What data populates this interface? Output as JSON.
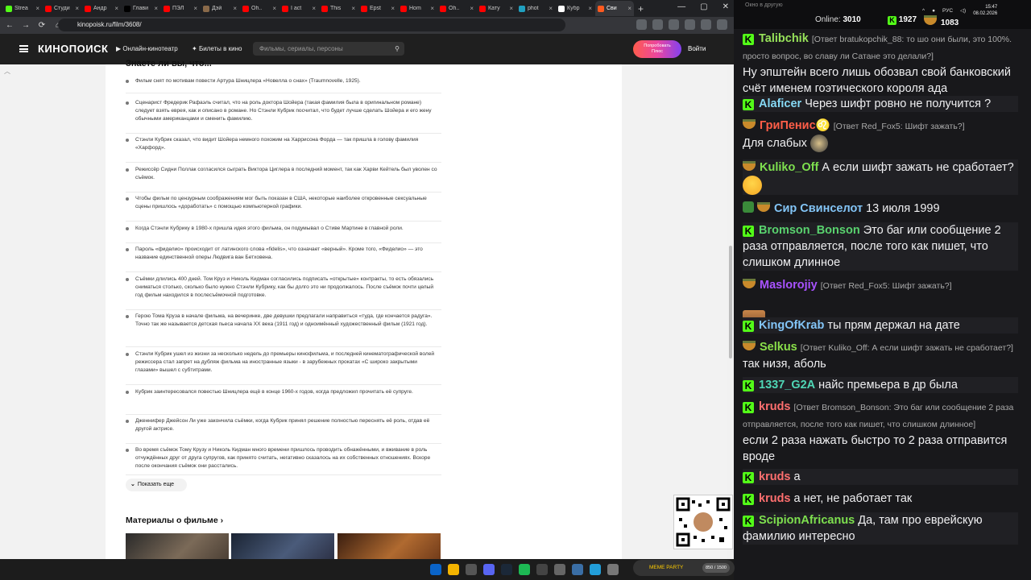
{
  "browser": {
    "tabs": [
      {
        "label": "Strea",
        "color": "#53fc18"
      },
      {
        "label": "Студи",
        "color": "#ff0000"
      },
      {
        "label": "Андр",
        "color": "#ff0000"
      },
      {
        "label": "Глави",
        "color": "#000000"
      },
      {
        "label": "ПЭЛ",
        "color": "#ff0000"
      },
      {
        "label": "Дэй",
        "color": "#8a6a4a"
      },
      {
        "label": "Oh..",
        "color": "#ff0000"
      },
      {
        "label": "I act",
        "color": "#ff0000"
      },
      {
        "label": "This",
        "color": "#ff0000"
      },
      {
        "label": "Epst",
        "color": "#ff0000"
      },
      {
        "label": "Hom",
        "color": "#ff0000"
      },
      {
        "label": "Oh..",
        "color": "#ff0000"
      },
      {
        "label": "Кату",
        "color": "#ff0000"
      },
      {
        "label": "phot",
        "color": "#20a0c0"
      },
      {
        "label": "Кубр",
        "color": "#ffffff"
      },
      {
        "label": "Сви",
        "color": "#ff5a1f",
        "active": true
      }
    ],
    "url": "kinopoisk.ru/film/3608/"
  },
  "header": {
    "logo": "КИНОПОИСК",
    "nav1": "Онлайн-кинотеатр",
    "nav2": "Билеты в кино",
    "search_placeholder": "Фильмы, сериалы, персоны",
    "try_line1": "Попробовать",
    "try_line2": "Плюс",
    "login": "Войти"
  },
  "content": {
    "section_title": "Знаете ли вы, что...",
    "facts": [
      "Фильм снят по мотивам повести Артура Шницлера «Новелла о снах» (Traumnovelle, 1925).",
      "Сценарист Фредерик Рафаэль считал, что на роль доктора Шойера (такая фамилия была в оригинальном романе) следует взять еврея, как и описано в романе. Но Стэнли Кубрик посчитал, что будет лучше сделать Шойера и его жену обычными американцами и сменить фамилию.",
      "Стэнли Кубрик сказал, что видит Шойера немного похожим на Харрисона Форда — так пришла в голову фамилия «Харфорд».",
      "Режиссёр Сидни Поллак согласился сыграть Виктора Циглера в последний момент, так как Харви Кейтель был уволен со съёмок.",
      "Чтобы фильм по цензурным соображениям мог быть показан в США, некоторые наиболее откровенные сексуальные сцены пришлось «доработать» с помощью компьютерной графики.",
      "Когда Стэнли Кубрику в 1980-х пришла идея этого фильма, он подумывал о Стиве Мартине в главной роли.",
      "Пароль «фиделио» происходит от латинского слова «fidelis», что означает «верный». Кроме того, «Фиделио» — это название единственной оперы Людвига ван Бетховена.",
      "Съёмки длились 400 дней. Том Круз и Николь Кидман согласились подписать «открытые» контракты, то есть обязались сниматься столько, сколько было нужно Стэнли Кубрику, как бы долго это ни продолжалось. После съёмок почти целый год фильм находился в послесъёмочной подготовке.",
      "Герою Тома Круза в начале фильма, на вечеринке, две девушки предлагали направиться «туда, где кончается радуга». Точно так же называется детская пьеса начала XX века (1911 год) и одноимённый художественный фильм (1921 год).",
      "Стэнли Кубрик ушел из жизни за несколько недель до премьеры кинофильма, и последней кинематографической волей режиссера стал запрет на дубляж фильма на иностранные языки - в зарубежных прокатах «С широко закрытыми глазами» вышел с субтитрами.",
      "Кубрик заинтересовался повестью Шницлера ещё в конце 1960-х годов, когда предложил прочитать её супруге.",
      "Дженнифер Джейсон Ли уже закончила съёмки, когда Кубрик принял решение полностью переснять её роль, отдав её другой актрисе.",
      "Во время съёмок Тому Крузу и Николь Кидман много времени пришлось проводить обнажёнными, и вживание в роль отчуждённых друг от друга супругов, как принято считать, негативно сказалось на их собственных отношениях. Вскоре после окончания съёмок они расстались."
    ],
    "show_more": "Показать еще",
    "materials_title": "Материалы о фильме"
  },
  "stream": {
    "chat_title": "Окно в другую",
    "online_label": "Online:",
    "online_count": "3010",
    "kick_count": "1927",
    "bear_count": "1083",
    "banner": "MEME PARTY",
    "banner_count": "850 / 1500"
  },
  "chat": [
    {
      "user": "Talibchik",
      "color": "#97e25a",
      "badge": "k",
      "reply": "[Ответ bratukopchik_88: то шо они были, это 100%. просто вопрос, во славу ли Сатане это делали?]",
      "text": "Ну эпштейн всего лишь обозвал свой банковский счёт именем гоэтического короля ада"
    },
    {
      "user": "Alaficer",
      "color": "#86d9f5",
      "badge": "k",
      "reply": "",
      "text": "Через шифт ровно не получится ?"
    },
    {
      "user": "ГриПенис♌",
      "color": "#ff5e48",
      "badge": "bowl",
      "reply": "[Ответ Red_Fox5: Шифт зажать?]",
      "text": "Для слабых"
    },
    {
      "user": "Kuliko_Off",
      "color": "#7ee04f",
      "badge": "bowl",
      "reply": "",
      "text": "А если шифт зажать не сработает?"
    },
    {
      "user": "Сир Свинселот",
      "color": "#83c5f7",
      "badge": "shield",
      "reply": "",
      "text": "13 июля 1999"
    },
    {
      "user": "Bromson_Bonson",
      "color": "#59d26e",
      "badge": "k",
      "reply": "",
      "text": "Это баг или сообщение 2 раза отправляется, после того как пишет, что слишком длинное"
    },
    {
      "user": "Maslorojiy",
      "color": "#a852ff",
      "badge": "bowl",
      "reply": "[Ответ Red_Fox5: Шифт зажать?]",
      "text": ""
    },
    {
      "user": "KingOfKrab",
      "color": "#83c5f7",
      "badge": "k",
      "reply": "",
      "text": "ты прям держал на дате"
    },
    {
      "user": "Selkus",
      "color": "#8ae04a",
      "badge": "bowl",
      "reply": "[Ответ Kuliko_Off: А если шифт зажать не сработает?]",
      "text": "так низя, аболь"
    },
    {
      "user": "1337_G2A",
      "color": "#4fd7b6",
      "badge": "k",
      "reply": "",
      "text": "найс премьера в др была"
    },
    {
      "user": "kruds",
      "color": "#ff6f6f",
      "badge": "k",
      "reply": "[Ответ Bromson_Bonson: Это баг или сообщение 2 раза отправляется, после того как пишет, что слишком длинное]",
      "text": "если 2 раза нажать быстро то 2 раза отправится вроде"
    },
    {
      "user": "kruds",
      "color": "#ff6f6f",
      "badge": "k",
      "reply": "",
      "text": "а"
    },
    {
      "user": "kruds",
      "color": "#ff6f6f",
      "badge": "k",
      "reply": "",
      "text": "а нет, не работает так"
    },
    {
      "user": "ScipionAfricanus",
      "color": "#7ee04f",
      "badge": "k",
      "reply": "",
      "text": "Да, там про еврейскую фамилию интересно"
    }
  ],
  "taskbar": {
    "lang": "РУС",
    "time": "15:47",
    "date": "08.02.2026"
  }
}
